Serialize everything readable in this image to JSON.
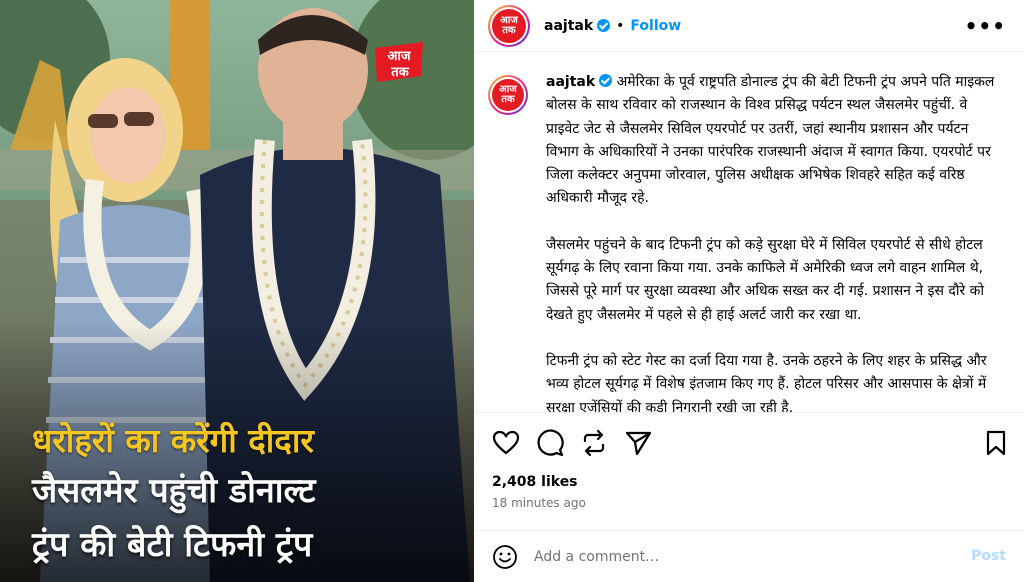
{
  "media": {
    "logo_text_top": "आज",
    "logo_text_bottom": "तक",
    "headline": [
      "धरोहरों का करेंगी दीदार",
      "जैसलमेर पहुंची डोनाल्ट",
      "ट्रंप की बेटी टिफनी ट्रंप"
    ]
  },
  "header": {
    "avatar_text_top": "आज",
    "avatar_text_bottom": "तक",
    "username": "aajtak",
    "separator": "•",
    "follow_label": "Follow",
    "more_label": "•••"
  },
  "caption": {
    "username": "aajtak",
    "paragraphs": [
      "अमेरिका के पूर्व राष्ट्रपति डोनाल्ड ट्रंप की बेटी टिफनी ट्रंप अपने पति माइकल बोलस के साथ रविवार को राजस्थान के विश्व प्रसिद्ध पर्यटन स्थल जैसलमेर पहुंचीं. वे प्राइवेट जेट से जैसलमेर सिविल एयरपोर्ट पर उतरीं, जहां स्थानीय प्रशासन और पर्यटन विभाग के अधिकारियों ने उनका पारंपरिक राजस्थानी अंदाज में स्वागत किया. एयरपोर्ट पर जिला कलेक्टर अनुपमा जोरवाल, पुलिस अधीक्षक अभिषेक शिवहरे सहित कई वरिष्ठ अधिकारी मौजूद रहे.",
      "जैसलमेर पहुंचने के बाद टिफनी ट्रंप को कड़े सुरक्षा घेरे में सिविल एयरपोर्ट से सीधे होटल सूर्यगढ़ के लिए रवाना किया गया. उनके काफिले में अमेरिकी ध्वज लगे वाहन शामिल थे, जिससे पूरे मार्ग पर सुरक्षा व्यवस्था और अधिक सख्त कर दी गई. प्रशासन ने इस दौरे को देखते हुए जैसलमेर में पहले से ही हाई अलर्ट जारी कर रखा था.",
      "टिफनी ट्रंप को स्टेट गेस्ट का दर्जा दिया गया है. उनके ठहरने के लिए शहर के प्रसिद्ध और भव्य होटल सूर्यगढ़ में विशेष इंतजाम किए गए हैं. होटल परिसर और आसपास के क्षेत्रों में सुरक्षा एजेंसियों की कडी निगरानी रखी जा रही है."
    ]
  },
  "stats": {
    "likes": "2,408 likes",
    "time_ago": "18 minutes ago"
  },
  "comment": {
    "placeholder": "Add a comment…",
    "post_label": "Post"
  },
  "colors": {
    "accent": "#0095f6",
    "headline_yellow": "#f5c61f",
    "brand_red": "#e51b23"
  }
}
